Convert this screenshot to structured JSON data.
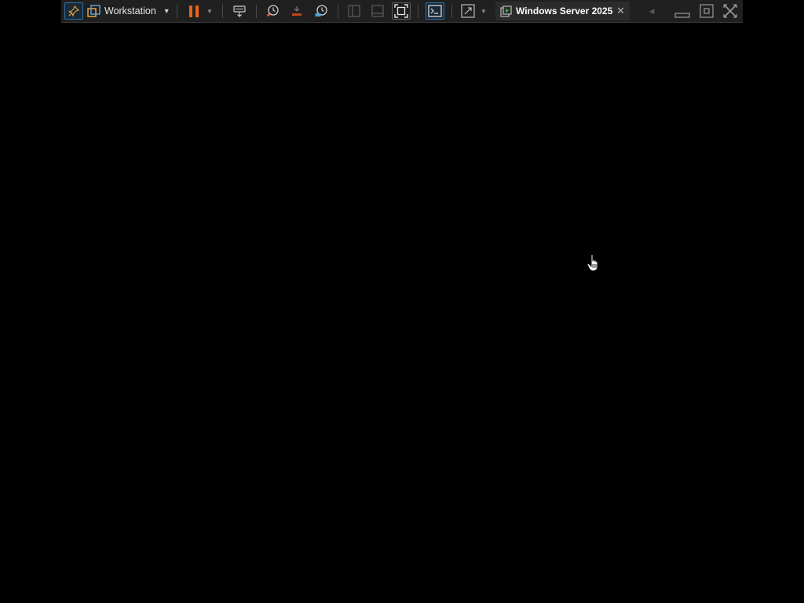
{
  "toolbar": {
    "menu_label": "Workstation",
    "vm_tab_title": "Windows Server 2025",
    "icons": {
      "pin": "pin-icon",
      "vm": "vm-library-icon",
      "menu_caret": "chevron-down-icon",
      "pause": "pause-icon",
      "send_keys": "send-ctrl-alt-del-icon",
      "snapshot": "take-snapshot-icon",
      "revert": "revert-snapshot-icon",
      "snapshot_manager": "snapshot-manager-icon",
      "sidebar": "show-library-icon",
      "thumbnail": "thumbnail-bar-icon",
      "fullscreen": "fullscreen-icon",
      "console": "console-view-icon",
      "stretch": "stretch-guest-icon",
      "tab_vm": "vm-running-icon",
      "tab_close": "close-icon",
      "scroll_left": "scroll-left-icon",
      "minimize": "minimize-icon",
      "restore": "restore-icon",
      "close": "close-icon"
    },
    "colors": {
      "toolbar_bg": "#202020",
      "accent_orange": "#e8641e",
      "accent_blue": "#2f6fa8",
      "guest_bg": "#000000"
    }
  }
}
